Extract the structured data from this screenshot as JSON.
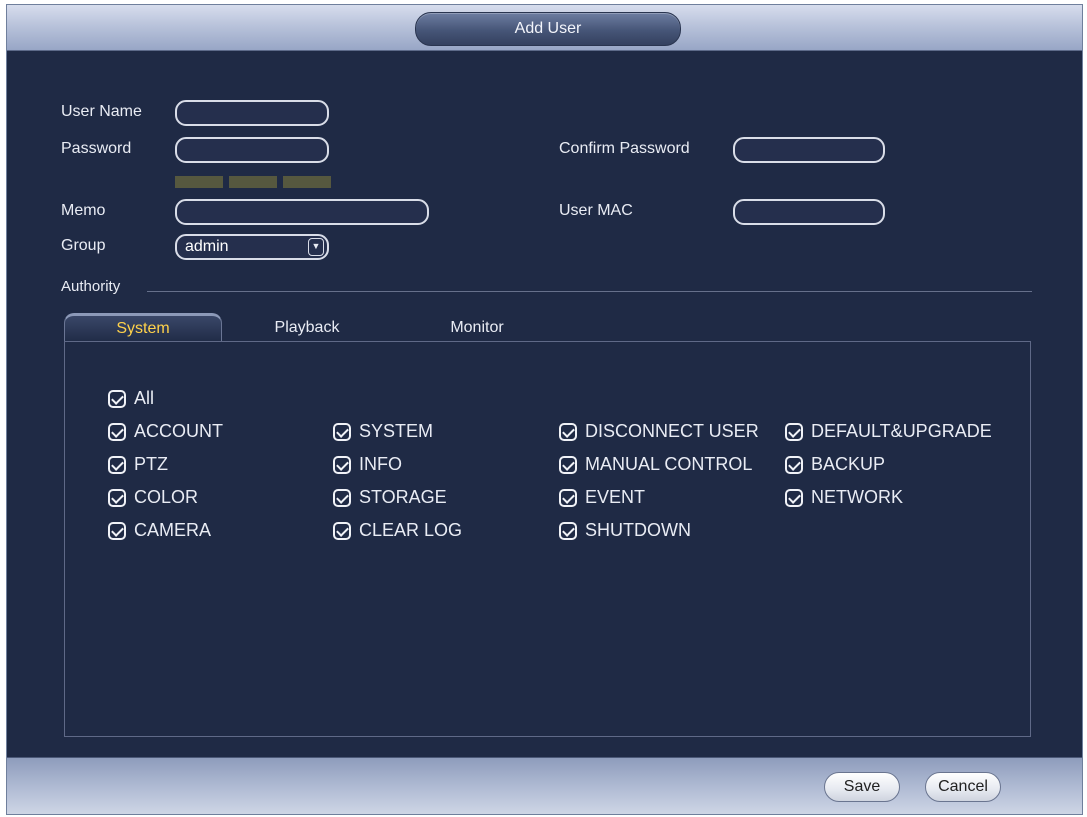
{
  "dialog": {
    "title": "Add User"
  },
  "form": {
    "user_name": {
      "label": "User Name",
      "value": ""
    },
    "password": {
      "label": "Password",
      "value": ""
    },
    "confirm_password": {
      "label": "Confirm Password",
      "value": ""
    },
    "memo": {
      "label": "Memo",
      "value": ""
    },
    "user_mac": {
      "label": "User MAC",
      "value": ""
    },
    "group": {
      "label": "Group",
      "selected": "admin"
    },
    "authority_label": "Authority"
  },
  "tabs": [
    {
      "label": "System",
      "active": true
    },
    {
      "label": "Playback",
      "active": false
    },
    {
      "label": "Monitor",
      "active": false
    }
  ],
  "permissions": {
    "all": "All",
    "col1": [
      "ACCOUNT",
      "PTZ",
      "COLOR",
      "CAMERA"
    ],
    "col2": [
      "SYSTEM",
      "INFO",
      "STORAGE",
      "CLEAR LOG"
    ],
    "col3": [
      "DISCONNECT USER",
      "MANUAL CONTROL",
      "EVENT",
      "SHUTDOWN"
    ],
    "col4": [
      "DEFAULT&UPGRADE",
      "BACKUP",
      "NETWORK"
    ]
  },
  "buttons": {
    "save": "Save",
    "cancel": "Cancel"
  },
  "colors": {
    "background": "#1f2a45",
    "active_tab": "#ffd24a",
    "password_strength": "#56583f"
  }
}
